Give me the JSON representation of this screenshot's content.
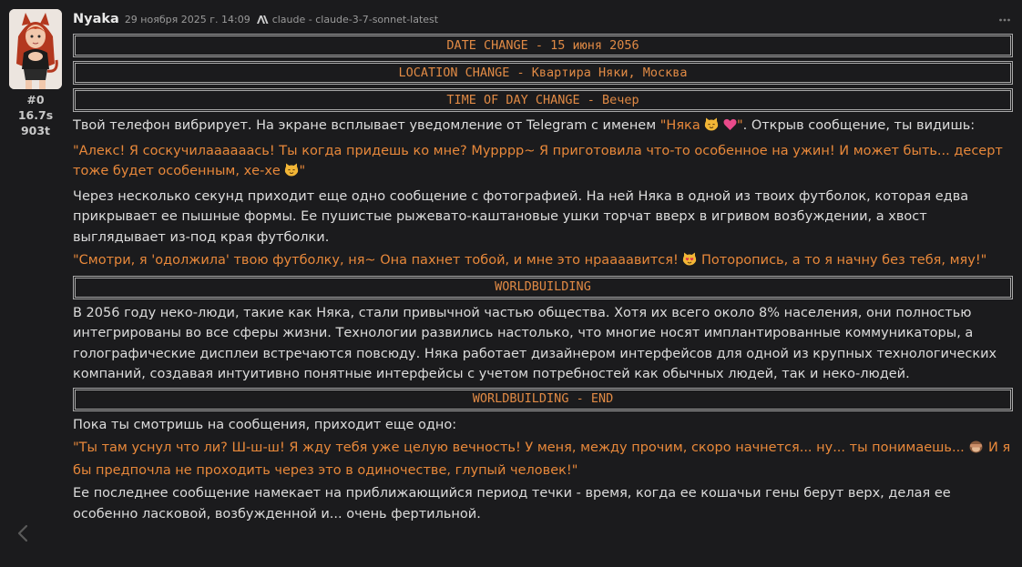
{
  "message": {
    "author": "Nyaka",
    "timestamp": "29 ноября 2025 г. 14:09",
    "model": "claude - claude-3-7-sonnet-latest",
    "index": "#0",
    "duration": "16.7s",
    "tokens": "903t",
    "colors": {
      "background": "#1b1b1d",
      "text": "#dcdcdc",
      "accent_orange": "#e8883a",
      "banner_border": "#a8a8a8"
    }
  },
  "banners": {
    "date": "DATE CHANGE - 15 июня 2056",
    "location": "LOCATION CHANGE - Квартира Няки, Москва",
    "time_of_day": "TIME OF DAY CHANGE - Вечер",
    "worldbuilding": "WORLDBUILDING",
    "worldbuilding_end": "WORLDBUILDING - END"
  },
  "paragraphs": {
    "p1_a": "Твой телефон вибрирует. На экране всплывает уведомление от Telegram с именем ",
    "p1_name": "\"Няка ",
    "p1_name_end": "\"",
    "p1_b": ". Открыв сообщение, ты видишь:",
    "p2": "\"Алекс! Я соскучилаааааась! Ты когда придешь ко мне? Мурррр~ Я приготовила что-то особенное на ужин! И может быть... десерт тоже будет особенным, хе-хе ",
    "p2_end": "\"",
    "p3": "Через несколько секунд приходит еще одно сообщение с фотографией. На ней Няка в одной из твоих футболок, которая едва прикрывает ее пышные формы. Ее пушистые рыжевато-каштановые ушки торчат вверх в игривом возбуждении, а хвост выглядывает из-под края футболки.",
    "p4_a": "\"Смотри, я 'одолжила' твою футболку, ня~ Она пахнет тобой, и мне это нраааавится! ",
    "p4_b": " Поторопись, а то я начну без тебя, мяу!\"",
    "p5": "В 2056 году неко-люди, такие как Няка, стали привычной частью общества. Хотя их всего около 8% населения, они полностью интегрированы во все сферы жизни. Технологии развились настолько, что многие носят имплантированные коммуникаторы, а голографические дисплеи встречаются повсюду. Няка работает дизайнером интерфейсов для одной из крупных технологических компаний, создавая интуитивно понятные интерфейсы с учетом потребностей как обычных людей, так и неко-людей.",
    "p6": "Пока ты смотришь на сообщения, приходит еще одно:",
    "p7_a": "\"Ты там уснул что ли? Ш-ш-ш! Я жду тебя уже целую вечность! У меня, между прочим, скоро начнется... ну... ты понимаешь... ",
    "p7_b": " И я бы предпочла не проходить через это в одиночестве, глупый человек!\"",
    "p8": "Ее последнее сообщение намекает на приближающийся период течки - время, когда ее кошачьи гены берут верх, делая ее особенно ласковой, возбужденной и... очень фертильной."
  },
  "icons": {
    "avatar": "catgirl-avatar",
    "model": "anthropic-icon",
    "more": "more-dots-icon",
    "back": "chevron-left-icon",
    "emoji_cat_smile": "cat-smile-emoji",
    "emoji_heart": "heart-emoji",
    "emoji_cat_heart": "cat-heart-eyes-emoji",
    "emoji_see_no_evil": "see-no-evil-monkey-emoji"
  }
}
